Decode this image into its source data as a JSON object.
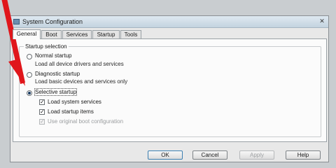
{
  "window": {
    "title": "System Configuration",
    "close_glyph": "✕"
  },
  "tabs": [
    "General",
    "Boot",
    "Services",
    "Startup",
    "Tools"
  ],
  "startup_selection": {
    "legend": "Startup selection",
    "normal": {
      "label": "Normal startup",
      "desc": "Load all device drivers and services"
    },
    "diagnostic": {
      "label": "Diagnostic startup",
      "desc": "Load basic devices and services only"
    },
    "selective": {
      "label": "Selective startup",
      "options": [
        {
          "label": "Load system services",
          "checked": true,
          "enabled": true
        },
        {
          "label": "Load startup items",
          "checked": true,
          "enabled": true
        },
        {
          "label": "Use original boot configuration",
          "checked": true,
          "enabled": false
        }
      ]
    },
    "selected": "selective"
  },
  "buttons": {
    "ok": "OK",
    "cancel": "Cancel",
    "apply": "Apply",
    "help": "Help"
  },
  "arrow": {
    "color": "#e0161b"
  }
}
